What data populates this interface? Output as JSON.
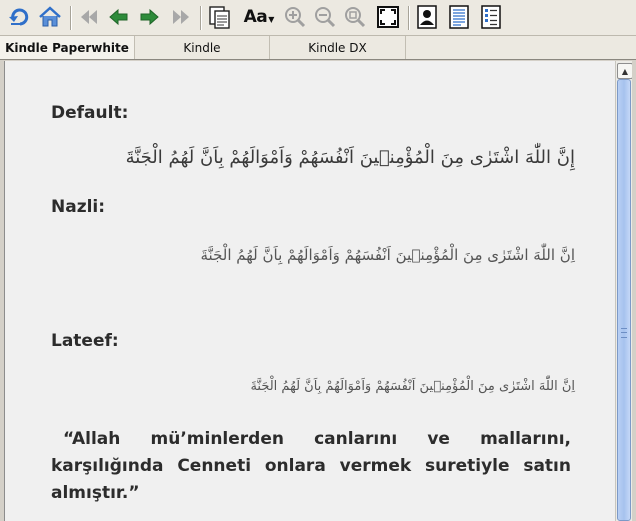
{
  "toolbar": {
    "aa_label": "Aa",
    "icons": [
      "rotate-icon",
      "home-icon",
      "first-page-icon",
      "prev-icon",
      "next-icon",
      "last-page-icon",
      "pages-icon",
      "font-size-icon",
      "zoom-in-icon",
      "zoom-out-icon",
      "zoom-reset-icon",
      "fit-page-icon",
      "portrait-icon",
      "document-icon",
      "list-icon"
    ]
  },
  "tabs": [
    {
      "label": "Kindle Paperwhite",
      "active": true
    },
    {
      "label": "Kindle",
      "active": false
    },
    {
      "label": "Kindle DX",
      "active": false
    }
  ],
  "content": {
    "sections": [
      {
        "heading": "Default:",
        "arabic": "إِنَّ اللّٰهَ اشْتَرٰى مِنَ الْمُؤْمِن۪ينَ اَنْفُسَهُمْ وَاَمْوَالَهُمْ بِاَنَّ لَهُمُ الْجَنَّةَ"
      },
      {
        "heading": "Nazli:",
        "arabic": "اِنَّ اللّٰهَ اشْتَرٰى مِنَ الْمُؤْمِن۪ينَ اَنْفُسَهُمْ وَاَمْوَالَهُمْ بِاَنَّ لَهُمُ الْجَنَّةَ"
      },
      {
        "heading": "Lateef:",
        "arabic": "اِنَّ اللّٰهَ اشْتَرٰى مِنَ الْمُؤْمِن۪ينَ اَنْفُسَهُمْ وَاَمْوَالَهُمْ بِاَنَّ لَهُمُ الْجَنَّةَ"
      }
    ],
    "quote": "“Allah mü’minlerden canlarını ve mallarını, karşılığında Cenneti onlara vermek suretiyle satın almıştır.”"
  },
  "colors": {
    "accent": "#2f6fc9",
    "green": "#2e8b3a",
    "gray": "#9a9a9a"
  }
}
